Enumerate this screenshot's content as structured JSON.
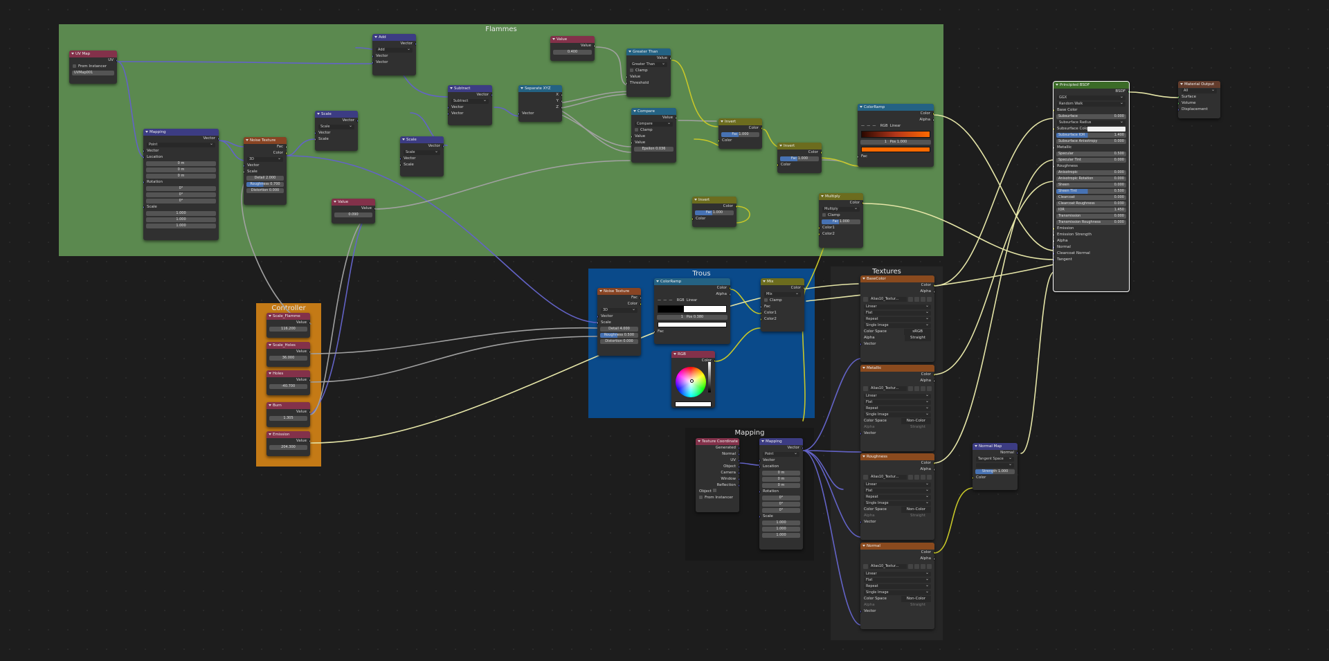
{
  "colors": {
    "frame_flammes": "#5b894f",
    "frame_trous": "#0a4a8a",
    "frame_controller": "#c47a16",
    "frame_textures": "#262626",
    "frame_mapping": "#181818",
    "wire_color": "#c7c729",
    "wire_gray": "#a1a1a1",
    "wire_vector": "#6363c7"
  },
  "frames": {
    "flammes": "Flammes",
    "trous": "Trous",
    "controller": "Controller",
    "textures": "Textures",
    "mapping": "Mapping"
  },
  "common": {
    "vector": "Vector",
    "value": "Value",
    "color": "Color",
    "fac": "Fac",
    "alpha": "Alpha",
    "scale": "Scale",
    "detail": "Detail",
    "roughness": "Roughness",
    "distortion": "Distortion",
    "location": "Location",
    "rotation": "Rotation",
    "x": "X",
    "y": "Y",
    "z": "Z",
    "type": "Type",
    "point": "Point",
    "clamp": "Clamp",
    "color1": "Color1",
    "color2": "Color2",
    "rgb": "RGB",
    "linear": "Linear",
    "pos": "Pos",
    "threshold": "Threshold",
    "d3": "3D",
    "zero_m": "0 m",
    "zero_deg": "0°",
    "one": "1.000",
    "one_short": "1",
    "normal": "Normal",
    "strength": "Strength",
    "colorspace": "Color Space",
    "srgb": "sRGB",
    "noncolor": "Non-Color",
    "flat": "Flat",
    "repeat": "Repeat",
    "single_image": "Single Image",
    "straight": "Straight",
    "image_name": "Alias10_Textur...",
    "minus": "—"
  },
  "nodes": {
    "uvmap": {
      "title": "UV Map",
      "out": "UV",
      "from_instancer": "From Instancer",
      "map": "UVMap001"
    },
    "mapping1": {
      "title": "Mapping"
    },
    "noise1": {
      "title": "Noise Texture",
      "detail": "2.000",
      "roughness": "0.700",
      "distortion": "0.000"
    },
    "add": {
      "title": "Add",
      "op": "Add"
    },
    "scale1": {
      "title": "Scale",
      "op": "Scale"
    },
    "scale2": {
      "title": "Scale",
      "op": "Scale"
    },
    "subtract": {
      "title": "Subtract",
      "op": "Subtract"
    },
    "separate": {
      "title": "Separate XYZ"
    },
    "value_top": {
      "title": "Value",
      "val": "0.400"
    },
    "value_mid": {
      "title": "Value",
      "val": "0.090"
    },
    "greater": {
      "title": "Greater Than",
      "op": "Greater Than"
    },
    "compare": {
      "title": "Compare",
      "op": "Compare",
      "epsilon_label": "Epsilon",
      "epsilon": "0.036"
    },
    "invert1": {
      "title": "Invert",
      "fac": "1.000"
    },
    "invert2": {
      "title": "Invert",
      "fac": "1.000"
    },
    "invert3": {
      "title": "Invert",
      "fac": "1.000"
    },
    "ramp1": {
      "title": "ColorRamp",
      "pos_idx": "1",
      "pos": "1.000"
    },
    "multiply": {
      "title": "Multiply",
      "op": "Multiply",
      "fac": "1.000"
    },
    "noise2": {
      "title": "Noise Texture",
      "detail": "4.000",
      "roughness": "0.500",
      "distortion": "0.000"
    },
    "ramp2": {
      "title": "ColorRamp",
      "pos_idx": "1",
      "pos": "0.380"
    },
    "mix": {
      "title": "Mix",
      "op": "Mix"
    },
    "rgb": {
      "title": "RGB"
    },
    "ctrl_scale_flamme": {
      "title": "Scale_Flamme",
      "val": "116.200"
    },
    "ctrl_scale_holes": {
      "title": "Scale_Holes",
      "val": "36.000"
    },
    "ctrl_holes": {
      "title": "Holes",
      "val": "-40.700"
    },
    "ctrl_burn": {
      "title": "Burn",
      "val": "1.305"
    },
    "ctrl_emission": {
      "title": "Emission",
      "val": "204.300"
    },
    "texcoord": {
      "title": "Texture Coordinate",
      "outs": [
        "Generated",
        "Normal",
        "UV",
        "Object",
        "Camera",
        "Window",
        "Reflection"
      ],
      "object": "Object",
      "from_instancer": "From Instancer"
    },
    "mapping2": {
      "title": "Mapping"
    },
    "tex_basecolor": {
      "title": "BaseColor"
    },
    "tex_metallic": {
      "title": "Metallic"
    },
    "tex_roughness": {
      "title": "Roughness"
    },
    "tex_normal": {
      "title": "Normal"
    },
    "normalmap": {
      "title": "Normal Map",
      "space": "Tangent Space"
    },
    "bsdf": {
      "title": "Principled BSDF",
      "out": "BSDF",
      "dist": "GGX",
      "sss": "Random Walk",
      "rows": [
        {
          "k": "Base Color",
          "t": "socket"
        },
        {
          "k": "Subsurface",
          "v": "0.000",
          "t": "field"
        },
        {
          "k": "Subsurface Radius",
          "t": "drop"
        },
        {
          "k": "Subsurface Color",
          "t": "color"
        },
        {
          "k": "Subsurface IOR",
          "v": "1.400",
          "t": "bar"
        },
        {
          "k": "Subsurface Anisotropy",
          "v": "0.000",
          "t": "field"
        },
        {
          "k": "Metallic",
          "t": "socket"
        },
        {
          "k": "Specular",
          "v": "0.500",
          "t": "field"
        },
        {
          "k": "Specular Tint",
          "v": "0.000",
          "t": "field"
        },
        {
          "k": "Roughness",
          "t": "socket"
        },
        {
          "k": "Anisotropic",
          "v": "0.000",
          "t": "field"
        },
        {
          "k": "Anisotropic Rotation",
          "v": "0.000",
          "t": "field"
        },
        {
          "k": "Sheen",
          "v": "0.000",
          "t": "field"
        },
        {
          "k": "Sheen Tint",
          "v": "0.500",
          "t": "bar"
        },
        {
          "k": "Clearcoat",
          "v": "0.000",
          "t": "field"
        },
        {
          "k": "Clearcoat Roughness",
          "v": "0.030",
          "t": "field"
        },
        {
          "k": "IOR",
          "v": "1.450",
          "t": "field"
        },
        {
          "k": "Transmission",
          "v": "0.000",
          "t": "field"
        },
        {
          "k": "Transmission Roughness",
          "v": "0.000",
          "t": "field"
        },
        {
          "k": "Emission",
          "t": "socket"
        },
        {
          "k": "Emission Strength",
          "t": "socket"
        },
        {
          "k": "Alpha",
          "t": "socket"
        },
        {
          "k": "Normal",
          "t": "socket"
        },
        {
          "k": "Clearcoat Normal",
          "t": "socket"
        },
        {
          "k": "Tangent",
          "t": "socket"
        }
      ]
    },
    "matout": {
      "title": "Material Output",
      "target": "All",
      "inputs": [
        "Surface",
        "Volume",
        "Displacement"
      ]
    }
  }
}
